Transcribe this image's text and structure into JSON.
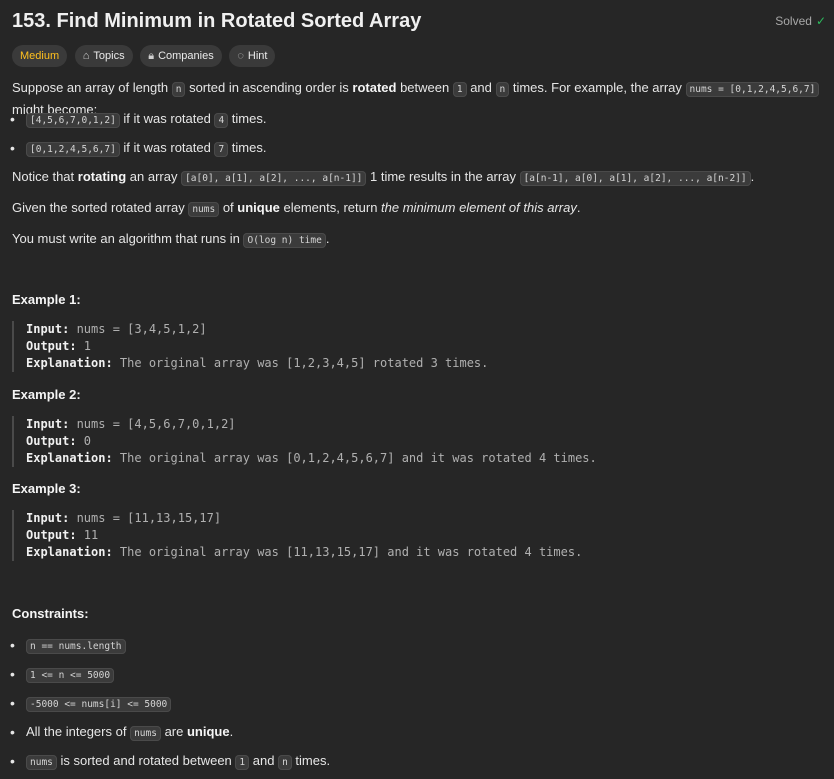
{
  "header": {
    "title": "153. Find Minimum in Rotated Sorted Array",
    "status": "Solved"
  },
  "tags": {
    "difficulty": "Medium",
    "topics": "Topics",
    "companies": "Companies",
    "hint": "Hint"
  },
  "desc": {
    "p1_a": "Suppose an array of length ",
    "p1_n1": "n",
    "p1_b": " sorted in ascending order is ",
    "p1_rot": "rotated",
    "p1_c": " between ",
    "p1_one": "1",
    "p1_d": " and ",
    "p1_n2": "n",
    "p1_e": " times. For example, the array ",
    "p1_code": "nums = [0,1,2,4,5,6,7]",
    "p1_f": " might become:",
    "b1_code": "[4,5,6,7,0,1,2]",
    "b1_a": " if it was rotated ",
    "b1_n": "4",
    "b1_b": " times.",
    "b2_code": "[0,1,2,4,5,6,7]",
    "b2_a": " if it was rotated ",
    "b2_n": "7",
    "b2_b": " times.",
    "p2_a": "Notice that ",
    "p2_rot": "rotating",
    "p2_b": " an array ",
    "p2_code1": "[a[0], a[1], a[2], ..., a[n-1]]",
    "p2_c": " 1 time results in the array ",
    "p2_code2": "[a[n-1], a[0], a[1], a[2], ..., a[n-2]]",
    "p2_d": ".",
    "p3_a": "Given the sorted rotated array ",
    "p3_code": "nums",
    "p3_b": " of ",
    "p3_uni": "unique",
    "p3_c": " elements, return ",
    "p3_it": "the minimum element of this array",
    "p3_d": ".",
    "p4_a": "You must write an algorithm that runs in ",
    "p4_code": "O(log n) time",
    "p4_b": "."
  },
  "examples": [
    {
      "heading": "Example 1:",
      "input_label": "Input:",
      "input": " nums = [3,4,5,1,2]",
      "output_label": "Output:",
      "output": " 1",
      "expl_label": "Explanation:",
      "expl": " The original array was [1,2,3,4,5] rotated 3 times."
    },
    {
      "heading": "Example 2:",
      "input_label": "Input:",
      "input": " nums = [4,5,6,7,0,1,2]",
      "output_label": "Output:",
      "output": " 0",
      "expl_label": "Explanation:",
      "expl": " The original array was [0,1,2,4,5,6,7] and it was rotated 4 times."
    },
    {
      "heading": "Example 3:",
      "input_label": "Input:",
      "input": " nums = [11,13,15,17]",
      "output_label": "Output:",
      "output": " 11",
      "expl_label": "Explanation:",
      "expl": " The original array was [11,13,15,17] and it was rotated 4 times."
    }
  ],
  "constraints": {
    "heading": "Constraints:",
    "c1": "n == nums.length",
    "c2": "1 <= n <= 5000",
    "c3": "-5000 <= nums[i] <= 5000",
    "c4_a": "All the integers of ",
    "c4_code": "nums",
    "c4_b": " are ",
    "c4_uni": "unique",
    "c4_c": ".",
    "c5_code": "nums",
    "c5_a": " is sorted and rotated between ",
    "c5_one": "1",
    "c5_b": " and ",
    "c5_n": "n",
    "c5_c": " times."
  }
}
